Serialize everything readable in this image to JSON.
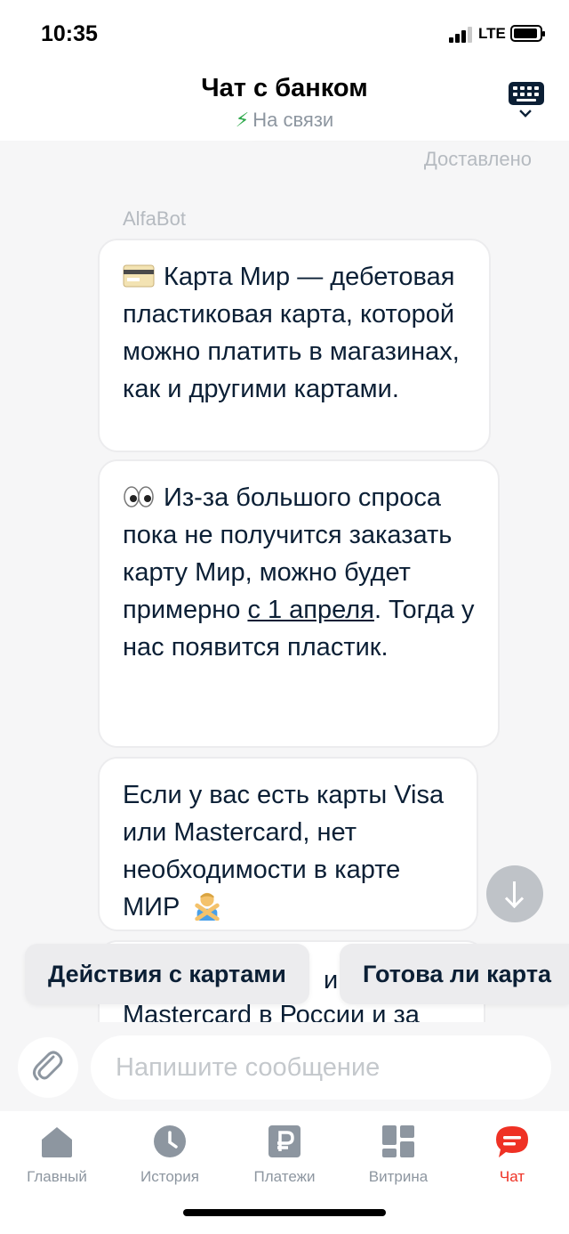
{
  "status_bar": {
    "time": "10:35",
    "network": "LTE"
  },
  "header": {
    "title": "Чат с банком",
    "status": "На связи"
  },
  "chat": {
    "delivered_label": "Доставлено",
    "sender": "AlfaBot",
    "messages": [
      {
        "emoji": "credit-card",
        "text": "Карта Мир — дебетовая пластиковая карта, которой можно платить в магазинах, как и другими картами."
      },
      {
        "emoji": "eyes",
        "text_before": "Из-за большого спроса пока не получится заказать карту Мир, можно будет примерно ",
        "link": "с 1 апреля",
        "text_after": ". Тогда у нас появится пластик."
      },
      {
        "emoji": "person-gesturing-no",
        "text": "Если у вас есть карты Visa или Mastercard, нет необходимости в карте МИР"
      },
      {
        "partial_text_1": "и",
        "partial_text_2": "Mastercard в России и за"
      }
    ]
  },
  "quick_replies": [
    "Действия с картами",
    "Готова ли карта"
  ],
  "input": {
    "placeholder": "Напишите сообщение"
  },
  "tabs": [
    {
      "label": "Главный",
      "icon": "home-icon"
    },
    {
      "label": "История",
      "icon": "clock-icon"
    },
    {
      "label": "Платежи",
      "icon": "ruble-icon"
    },
    {
      "label": "Витрина",
      "icon": "grid-icon"
    },
    {
      "label": "Чат",
      "icon": "chat-icon",
      "active": true
    }
  ],
  "colors": {
    "accent": "#ef3124",
    "text": "#0b1f35",
    "muted": "#8d96a0",
    "online": "#2ca84a",
    "background": "#f6f6f7"
  }
}
